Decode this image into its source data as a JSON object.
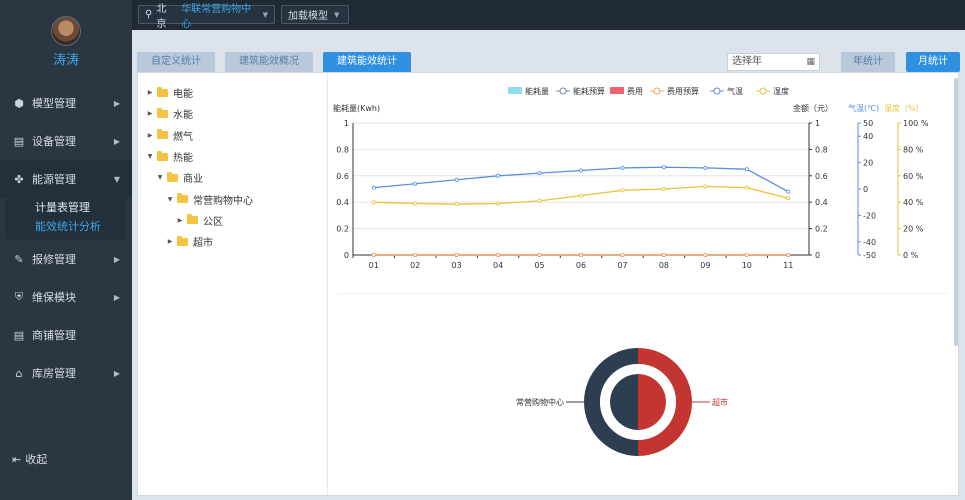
{
  "user": {
    "name": "涛涛"
  },
  "sidebar": {
    "items": [
      {
        "label": "模型管理",
        "icon": "cube-icon",
        "glyph": "⬢"
      },
      {
        "label": "设备管理",
        "icon": "printer-icon",
        "glyph": "▤"
      },
      {
        "label": "能源管理",
        "icon": "fan-icon",
        "glyph": "✤"
      },
      {
        "label": "报修管理",
        "icon": "wrench-icon",
        "glyph": "🔧"
      },
      {
        "label": "维保模块",
        "icon": "shield-icon",
        "glyph": "⛨"
      },
      {
        "label": "商铺管理",
        "icon": "printer-icon",
        "glyph": "▤"
      },
      {
        "label": "库房管理",
        "icon": "bank-icon",
        "glyph": "⌂"
      }
    ],
    "submenu": [
      "计量表管理",
      "能效统计分析"
    ],
    "collapse": "收起"
  },
  "topbar": {
    "location": "北京",
    "mall": "华联常营购物中心",
    "load_model": "加载模型"
  },
  "tabs": [
    "自定义统计",
    "建筑能效概况",
    "建筑能效统计"
  ],
  "year_placeholder": "选择年",
  "btn_year": "年统计",
  "btn_month": "月统计",
  "tree": [
    {
      "label": "电能",
      "level": 0,
      "open": false
    },
    {
      "label": "水能",
      "level": 0,
      "open": false
    },
    {
      "label": "燃气",
      "level": 0,
      "open": false
    },
    {
      "label": "热能",
      "level": 0,
      "open": true
    },
    {
      "label": "商业",
      "level": 1,
      "open": true
    },
    {
      "label": "常营购物中心",
      "level": 2,
      "open": true
    },
    {
      "label": "公区",
      "level": 3,
      "open": false
    },
    {
      "label": "超市",
      "level": 2,
      "open": false
    }
  ],
  "chart_data": [
    {
      "type": "line",
      "legend": [
        "能耗量",
        "能耗预算",
        "费用",
        "费用预算",
        "气温",
        "湿度"
      ],
      "categories": [
        "01",
        "02",
        "03",
        "04",
        "05",
        "06",
        "07",
        "08",
        "09",
        "10",
        "11"
      ],
      "axes": {
        "y_left": {
          "label": "能耗量(Kwh)",
          "min": 0,
          "max": 1,
          "ticks": [
            "0",
            "0.2",
            "0.4",
            "0.6",
            "0.8",
            "1"
          ]
        },
        "y_right": {
          "label": "金额（元）",
          "min": 0,
          "max": 1,
          "ticks": [
            "0",
            "0.2",
            "0.4",
            "0.6",
            "0.8",
            "1"
          ]
        },
        "y_temp": {
          "label": "气温(℃)",
          "min": -50,
          "max": 50,
          "ticks": [
            "-50",
            "-40",
            "-20",
            "0",
            "20",
            "40",
            "50"
          ]
        },
        "y_hum": {
          "label": "湿度（%）",
          "min": 0,
          "max": 100,
          "ticks": [
            "0 %",
            "20 %",
            "40 %",
            "60 %",
            "80 %",
            "100 %"
          ]
        }
      },
      "series": [
        {
          "name": "能耗量",
          "axis": "left",
          "values": [
            0,
            0,
            0,
            0,
            0,
            0,
            0,
            0,
            0,
            0,
            0
          ],
          "color": "#8fdcef"
        },
        {
          "name": "能耗预算",
          "axis": "left",
          "values": [
            0,
            0,
            0,
            0,
            0,
            0,
            0,
            0,
            0,
            0,
            0
          ],
          "color": "#7b8899"
        },
        {
          "name": "费用",
          "axis": "right",
          "values": [
            0,
            0,
            0,
            0,
            0,
            0,
            0,
            0,
            0,
            0,
            0
          ],
          "color": "#f0616b"
        },
        {
          "name": "费用预算",
          "axis": "right",
          "values": [
            0,
            0,
            0,
            0,
            0,
            0,
            0,
            0,
            0,
            0,
            0
          ],
          "color": "#f3a35e"
        },
        {
          "name": "气温",
          "axis": "temp",
          "values": [
            1,
            4,
            7,
            10,
            12,
            14,
            16,
            16.5,
            16,
            15,
            -2
          ],
          "color": "#5b8ee0"
        },
        {
          "name": "湿度",
          "axis": "hum",
          "values": [
            40,
            39,
            38.5,
            39,
            41,
            45,
            49,
            50,
            52,
            51,
            43
          ],
          "color": "#e8c23b"
        }
      ]
    },
    {
      "type": "pie",
      "slices": [
        {
          "name": "常营购物中心",
          "value": 50,
          "color": "#2c3e50"
        },
        {
          "name": "超市",
          "value": 50,
          "color": "#c23531"
        }
      ]
    }
  ]
}
